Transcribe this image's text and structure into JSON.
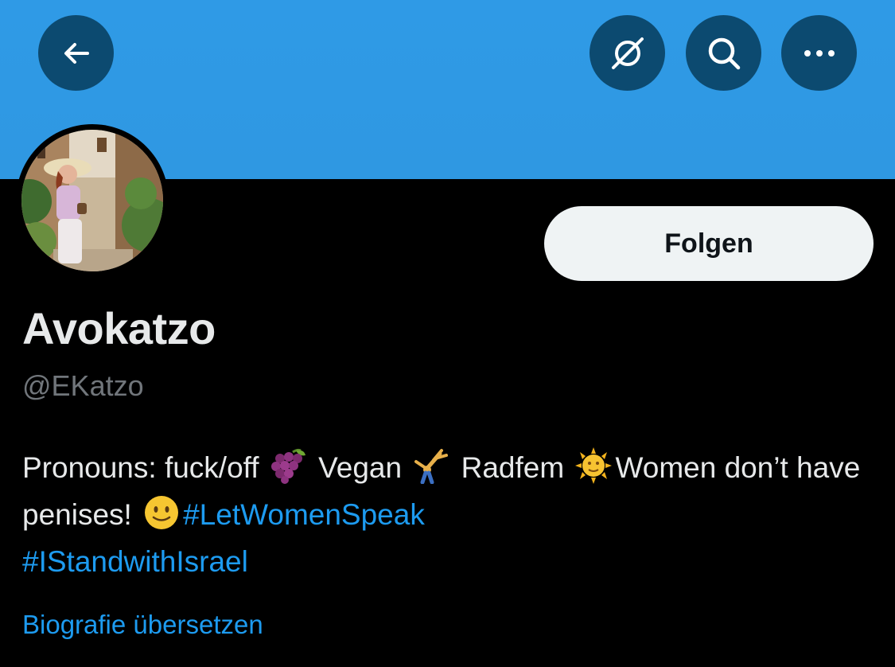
{
  "header": {
    "back_icon": "arrow-left-icon",
    "grok_icon": "slashed-circle-icon",
    "search_icon": "search-icon",
    "more_icon": "more-dots-icon",
    "banner_color": "#2f9ae6",
    "button_color": "#0c4a70"
  },
  "profile": {
    "avatar": "profile-photo",
    "follow_label": "Folgen",
    "display_name": "Avokatzo",
    "handle": "@EKatzo"
  },
  "bio": {
    "text_1": "Pronouns: fuck/off ",
    "emoji_grapes": "grapes-emoji",
    "text_2": " Vegan ",
    "emoji_cartwheel": "cartwheel-emoji",
    "text_3": " Radfem ",
    "emoji_sun": "sun-with-face-emoji",
    "text_4": "Women don’t have penises! ",
    "emoji_smile": "slightly-smiling-face-emoji",
    "hashtag_1": "#LetWomenSpeak",
    "hashtag_2": "#IStandwithIsrael",
    "link_color": "#1d9bf0"
  },
  "translate_label": "Biografie übersetzen"
}
